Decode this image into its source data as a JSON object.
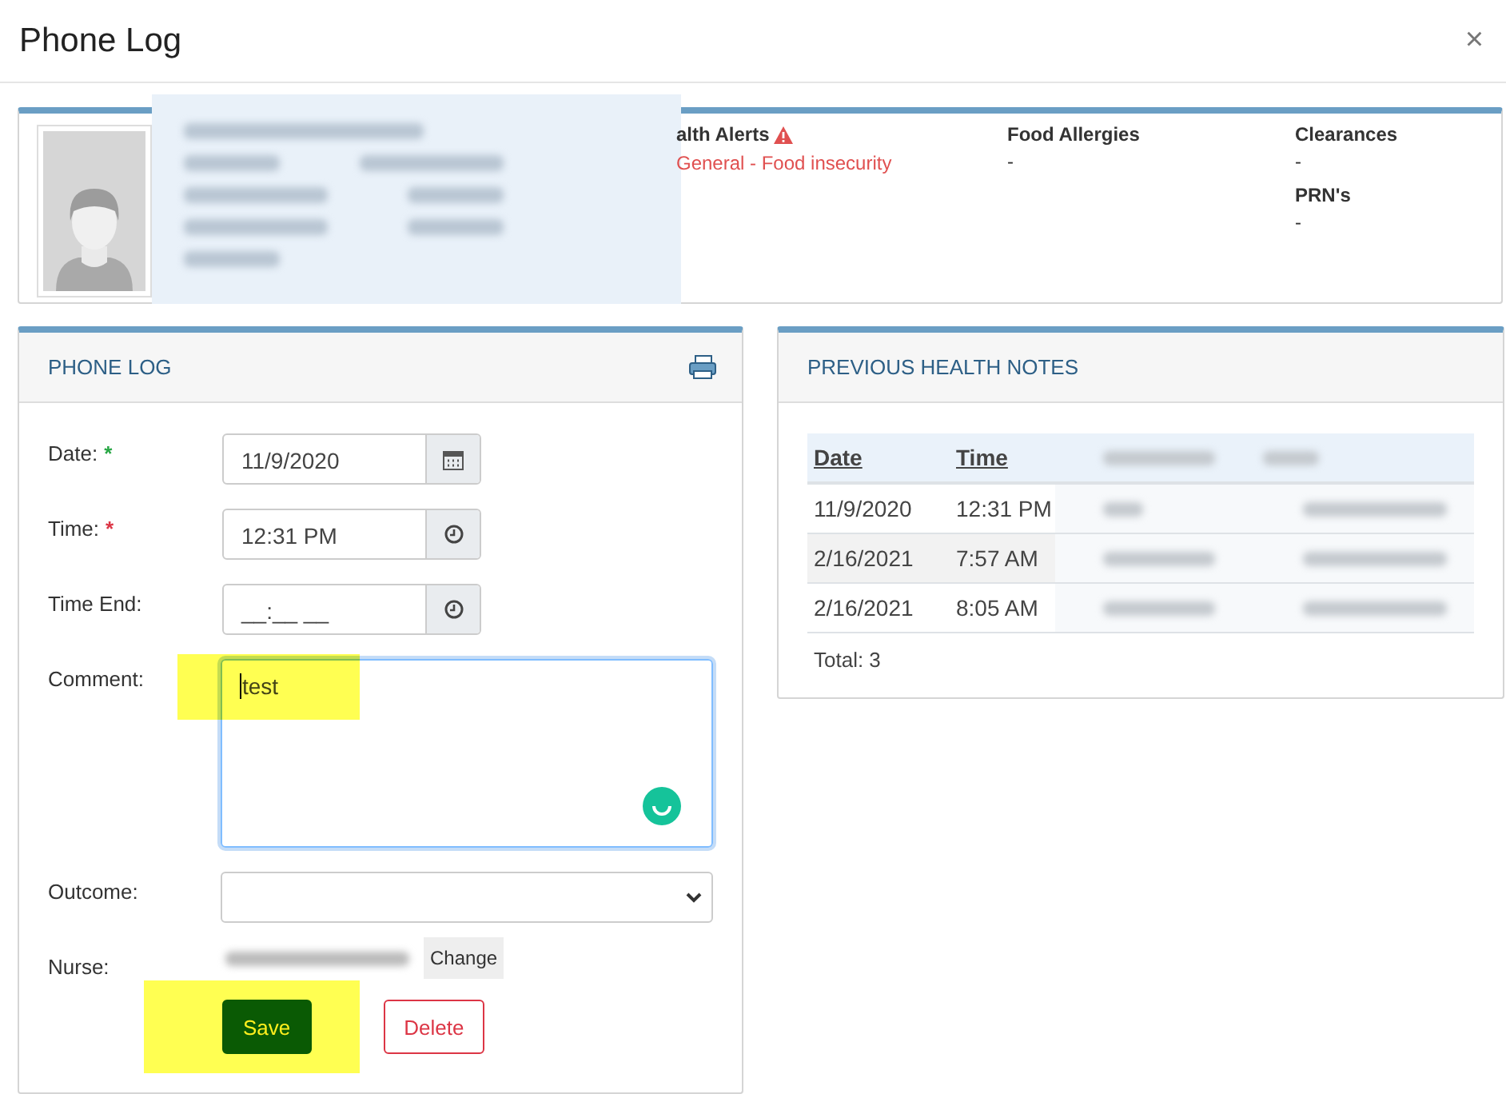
{
  "dialog": {
    "title": "Phone Log",
    "close": "×"
  },
  "patient": {
    "alerts": {
      "label": "alth Alerts",
      "items": [
        "General - Food insecurity"
      ]
    },
    "columns": [
      {
        "label": "Food Allergies",
        "value": "-"
      },
      {
        "label": "Clearances",
        "value": "-"
      },
      {
        "label": "PRN's",
        "value": "-"
      }
    ]
  },
  "phone_log": {
    "title": "PHONE LOG",
    "fields": [
      {
        "kind": "date",
        "label": "Date:",
        "required_mark": "*",
        "color": "#28a745",
        "value": "11/9/2020"
      },
      {
        "kind": "time",
        "label": "Time:",
        "required_mark": "*",
        "color": "#dc3545",
        "value": "12:31 PM"
      },
      {
        "kind": "time",
        "label": "Time End:",
        "value": "__:__ __"
      },
      {
        "kind": "textarea",
        "label": "Comment:",
        "value": "test",
        "focused": true,
        "highlighted": true
      },
      {
        "kind": "select",
        "label": "Outcome:"
      },
      {
        "kind": "nurse",
        "label": "Nurse:",
        "button": "Change"
      }
    ],
    "buttons": [
      {
        "kind": "primary",
        "label": "Save",
        "highlighted": true
      },
      {
        "kind": "danger",
        "label": "Delete"
      }
    ]
  },
  "notes": {
    "title": "PREVIOUS HEALTH NOTES",
    "columns": [
      "Date",
      "Time"
    ],
    "rows": [
      {
        "cells": [
          "11/9/2020",
          "12:31 PM"
        ]
      },
      {
        "cells": [
          "2/16/2021",
          "7:57 AM"
        ]
      },
      {
        "cells": [
          "2/16/2021",
          "8:05 AM"
        ]
      }
    ],
    "total": "Total: 3"
  }
}
